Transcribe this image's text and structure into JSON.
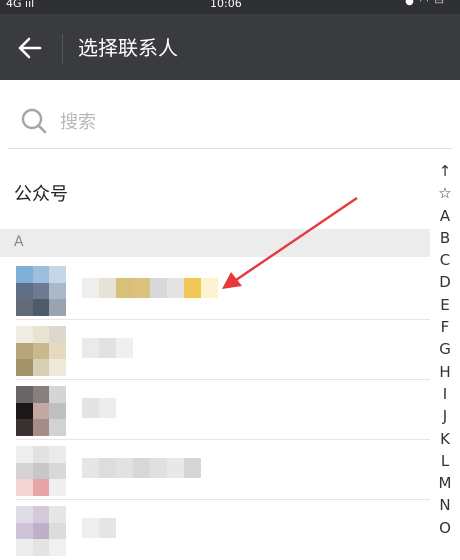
{
  "status_bar": {
    "network": "4G ııl",
    "time": "10:06",
    "icons": [
      "alarm-icon",
      "wifi-icon",
      "battery-icon"
    ],
    "background": "#2f3033"
  },
  "header": {
    "title": "选择联系人",
    "back_icon": "back-arrow-icon",
    "background": "#3a3b3f"
  },
  "search": {
    "placeholder": "搜索",
    "icon": "search-icon"
  },
  "section": {
    "label": "公众号"
  },
  "group": {
    "letter": "A"
  },
  "contacts": [
    {
      "avatar": [
        "#7fb0d8",
        "#9ebee0",
        "#c5d6e6",
        "#5f6f86",
        "#6d7a92",
        "#aab8c8",
        "#626b7a",
        "#4f5a6b",
        "#9aa3b0"
      ],
      "name": [
        "#eeeeee",
        "#e6e2d8",
        "#d9c07a",
        "#dcc27e",
        "#d8d8d8",
        "#e4e4e4",
        "#f2c75a",
        "#fdf3d0"
      ]
    },
    {
      "avatar": [
        "#f0ede4",
        "#e9e3d2",
        "#dcd8cc",
        "#b6a47a",
        "#c9b98c",
        "#e3dac0",
        "#a39368",
        "#d7cfb6",
        "#efe9da"
      ],
      "name": [
        "#eaeaea",
        "#e2e2e2",
        "#efefef"
      ]
    },
    {
      "avatar": [
        "#6b6466",
        "#8a7f7f",
        "#d5d5d5",
        "#1b1717",
        "#c2a7a2",
        "#bfbfbf",
        "#3b3030",
        "#a58c86",
        "#d2d2d2"
      ],
      "name": [
        "#e4e4e4",
        "#ececec"
      ]
    },
    {
      "avatar": [
        "#eeeeee",
        "#e2e2e2",
        "#ebebeb",
        "#d4d4d4",
        "#c8c8c8",
        "#d9d9d9",
        "#f4d3d3",
        "#e7a6a6",
        "#efefef"
      ],
      "name": [
        "#e6e6e6",
        "#dddddd",
        "#e2e2e2",
        "#d8d8d8",
        "#e0e0e0",
        "#e8e8e8",
        "#d6d6d6"
      ]
    },
    {
      "avatar": [
        "#e0dce6",
        "#d2cad8",
        "#e6e6e6",
        "#cfc3d8",
        "#bdb0c8",
        "#dcdcdc",
        "#ececec",
        "#e4e4e4",
        "#f0f0f0"
      ],
      "name": [
        "#eeeeee",
        "#e6e6e6"
      ]
    }
  ],
  "index": [
    "↑",
    "☆",
    "A",
    "B",
    "C",
    "D",
    "E",
    "F",
    "G",
    "H",
    "I",
    "J",
    "K",
    "L",
    "M",
    "N",
    "O"
  ],
  "annotation": {
    "color": "#e8393a"
  }
}
